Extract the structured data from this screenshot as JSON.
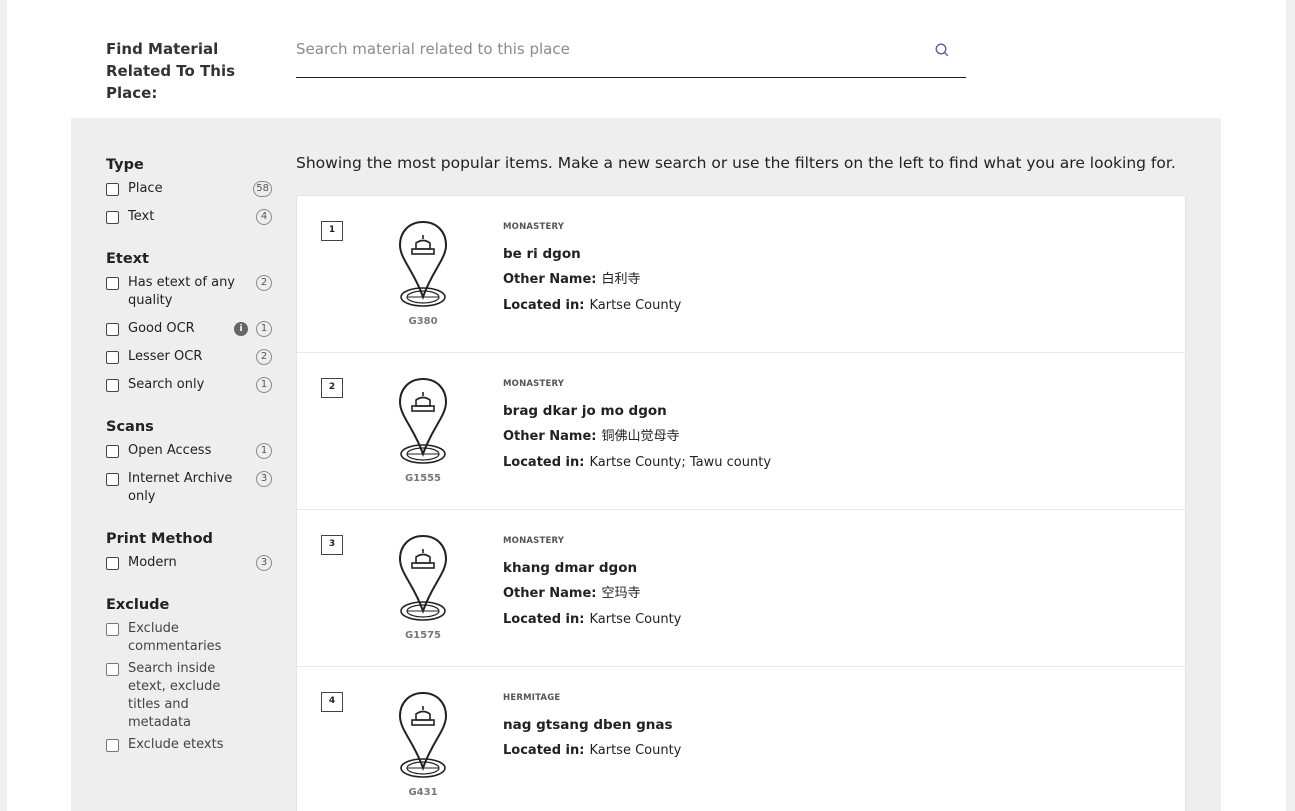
{
  "search": {
    "label": "Find Material Related To This Place:",
    "value": "",
    "placeholder": "Search material related to this place"
  },
  "intro_text": "Showing the most popular items. Make a new search or use the filters on the left to find what you are looking for.",
  "facets": {
    "type": {
      "title": "Type",
      "items": [
        {
          "label": "Place",
          "count": "58"
        },
        {
          "label": "Text",
          "count": "4"
        }
      ]
    },
    "etext": {
      "title": "Etext",
      "items": [
        {
          "label": "Has etext of any quality",
          "count": "2"
        },
        {
          "label": "Good OCR",
          "count": "1",
          "info": "i"
        },
        {
          "label": "Lesser OCR",
          "count": "2"
        },
        {
          "label": "Search only",
          "count": "1"
        }
      ]
    },
    "scans": {
      "title": "Scans",
      "items": [
        {
          "label": "Open Access",
          "count": "1"
        },
        {
          "label": "Internet Archive only",
          "count": "3"
        }
      ]
    },
    "print_method": {
      "title": "Print Method",
      "items": [
        {
          "label": "Modern",
          "count": "3"
        }
      ]
    },
    "exclude": {
      "title": "Exclude",
      "items": [
        {
          "label": "Exclude commentaries"
        },
        {
          "label": "Search inside etext, exclude titles and metadata"
        },
        {
          "label": "Exclude etexts"
        }
      ]
    }
  },
  "results": [
    {
      "rank": "1",
      "type": "MONASTERY",
      "title": "be ri dgon",
      "id": "G380",
      "other_name_label": "Other Name:",
      "other_name": "白利寺",
      "located_label": "Located in:",
      "located": "Kartse County"
    },
    {
      "rank": "2",
      "type": "MONASTERY",
      "title": "brag dkar jo mo dgon",
      "id": "G1555",
      "other_name_label": "Other Name:",
      "other_name": "铜佛山觉母寺",
      "located_label": "Located in:",
      "located": "Kartse County; Tawu county"
    },
    {
      "rank": "3",
      "type": "MONASTERY",
      "title": "khang dmar dgon",
      "id": "G1575",
      "other_name_label": "Other Name:",
      "other_name": "空玛寺",
      "located_label": "Located in:",
      "located": "Kartse County"
    },
    {
      "rank": "4",
      "type": "HERMITAGE",
      "title": "nag gtsang dben gnas",
      "id": "G431",
      "located_label": "Located in:",
      "located": "Kartse County"
    }
  ],
  "icons": {
    "search": "search-icon",
    "place": "place-pin-icon",
    "info": "info-icon"
  }
}
